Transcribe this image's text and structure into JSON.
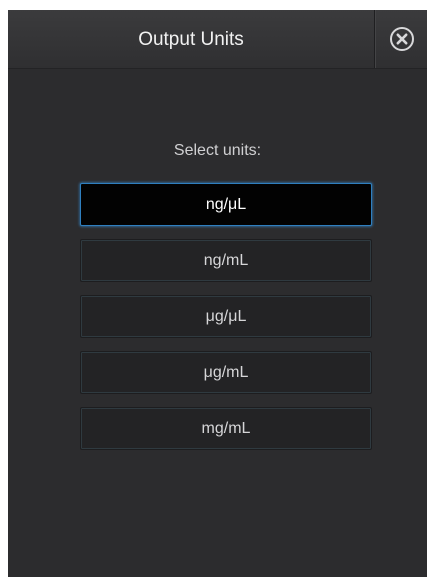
{
  "dialog": {
    "title": "Output Units",
    "close_icon": "close-circle-icon"
  },
  "prompt": "Select units:",
  "options": [
    {
      "label": "ng/μL",
      "selected": true
    },
    {
      "label": "ng/mL",
      "selected": false
    },
    {
      "label": "μg/μL",
      "selected": false
    },
    {
      "label": "μg/mL",
      "selected": false
    },
    {
      "label": "mg/mL",
      "selected": false
    }
  ],
  "colors": {
    "panel_background": "#2c2c2e",
    "selected_border": "#2f7fbf",
    "selected_background": "#020202"
  }
}
